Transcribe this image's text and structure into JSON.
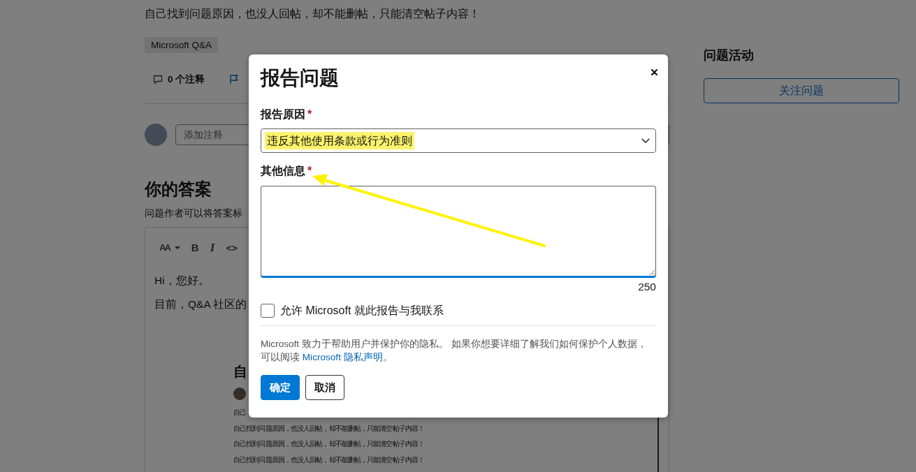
{
  "page": {
    "question_text": "自己找到问题原因，也没人回帖，却不能删帖，只能清空帖子内容！",
    "tags": [
      "Microsoft Q&A"
    ],
    "actions": [
      {
        "kind": "comment",
        "label": "0 个注释"
      },
      {
        "kind": "flag"
      }
    ],
    "comment_field": {
      "placeholder": "添加注释"
    },
    "answer": {
      "heading": "你的答案",
      "hint": "问题作者可以将答案标",
      "toolbar": [
        {
          "kind": "font_size",
          "label": "AA"
        },
        {
          "kind": "bold",
          "label": "B"
        },
        {
          "kind": "italic",
          "label": "I"
        },
        {
          "kind": "code",
          "label": "<>"
        }
      ],
      "body": [
        "Hi，您好。",
        "目前，Q&A 社区的"
      ],
      "embedded_screenshot": {
        "title": "自",
        "lines": [
          "自己",
          "自己找到问题原因，也没人回帖，却不能删帖，只能清空帖子内容！",
          "自己找到问题原因，也没人回帖，却不能删帖，只能清空帖子内容！",
          "自己找到问题原因，也没人回帖，却不能删帖，只能清空帖子内容！"
        ]
      }
    }
  },
  "sidebar": {
    "heading": "问题活动",
    "follow_button": "关注问题"
  },
  "dialog": {
    "title": "报告问题",
    "fields": [
      {
        "kind": "select",
        "label": "报告原因",
        "required_mark": "*",
        "value": "违反其他使用条款或行为准则",
        "highlighted": true
      },
      {
        "kind": "textarea",
        "label": "其他信息",
        "required_mark": "*",
        "focused": true,
        "counter": "250"
      }
    ],
    "checkbox": {
      "label": "允许 Microsoft 就此报告与我联系",
      "checked": false
    },
    "privacy": {
      "text": "Microsoft 致力于帮助用户并保护你的隐私。 如果你想要详细了解我们如何保护个人数据，可以阅读 ",
      "link": "Microsoft 隐私声明",
      "suffix": "。"
    },
    "buttons": [
      {
        "kind": "primary",
        "label": "确定"
      },
      {
        "kind": "secondary",
        "label": "取消"
      }
    ]
  }
}
